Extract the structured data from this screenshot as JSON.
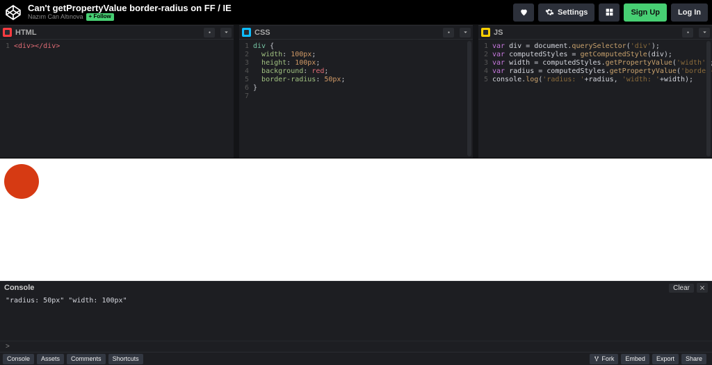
{
  "header": {
    "title": "Can't getPropertyValue border-radius on FF / IE",
    "author": "Nazım Can Altınova",
    "follow_label": "+ Follow",
    "buttons": {
      "settings": "Settings",
      "signup": "Sign Up",
      "login": "Log In"
    }
  },
  "editors": {
    "html": {
      "label": "HTML",
      "line_count": 1,
      "code": {
        "open_tag": "<div>",
        "close_tag": "</div>"
      }
    },
    "css": {
      "label": "CSS",
      "line_count": 7,
      "selector": "div",
      "open_brace": "{",
      "close_brace": "}",
      "props": {
        "width_k": "width",
        "width_v": "100px",
        "height_k": "height",
        "height_v": "100px",
        "bg_k": "background",
        "bg_v": "red",
        "br_k": "border-radius",
        "br_v": "50px"
      }
    },
    "js": {
      "label": "JS",
      "line_count": 5,
      "kw_var": "var",
      "l1": {
        "id": "div",
        "eq": " = ",
        "obj": "document",
        "dot": ".",
        "fn": "querySelector",
        "arg": "'div'"
      },
      "l2": {
        "id": "computedStyles",
        "eq": " = ",
        "fn": "getComputedStyle",
        "arg": "div"
      },
      "l3": {
        "id": "width",
        "eq": " = ",
        "obj": "computedStyles",
        "dot": ".",
        "fn": "getPropertyValue",
        "arg": "'width'"
      },
      "l4": {
        "id": "radius",
        "eq": " = ",
        "obj": "computedStyles",
        "dot": ".",
        "fn": "getPropertyValue",
        "arg": "'border-top-left-radius'"
      },
      "l5": {
        "obj": "console",
        "dot": ".",
        "fn": "log",
        "a1": "'radius: '",
        "p1": "+",
        "v1": "radius",
        "c": ", ",
        "a2": "'width: '",
        "p2": "+",
        "v2": "width"
      }
    }
  },
  "preview": {
    "circle_color": "#d63a13"
  },
  "console": {
    "label": "Console",
    "clear_label": "Clear",
    "output": "\"radius: 50px\" \"width: 100px\"",
    "prompt": ">"
  },
  "footer": {
    "left": {
      "console": "Console",
      "assets": "Assets",
      "comments": "Comments",
      "shortcuts": "Shortcuts"
    },
    "right": {
      "fork": "Fork",
      "embed": "Embed",
      "export": "Export",
      "share": "Share"
    }
  }
}
